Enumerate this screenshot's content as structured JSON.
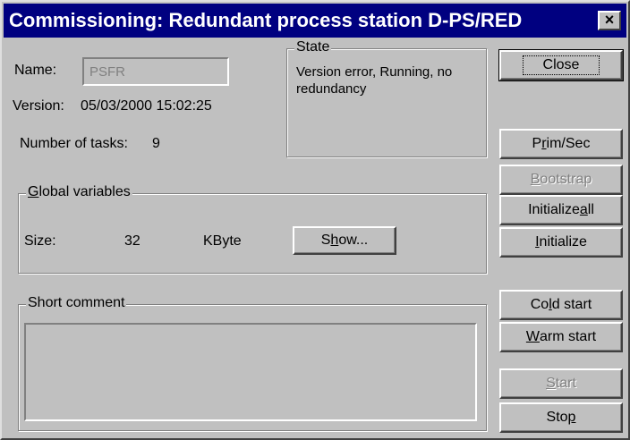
{
  "window": {
    "title": "Commissioning: Redundant process station D-PS/RED",
    "close_glyph": "×"
  },
  "name": {
    "label": "Name:",
    "value": "PSFR"
  },
  "version": {
    "label": "Version:",
    "value": "05/03/2000 15:02:25"
  },
  "tasks": {
    "label": "Number of tasks:",
    "value": "9"
  },
  "state": {
    "legend": "State",
    "text": "Version error, Running, no redundancy"
  },
  "global_vars": {
    "legend_pre": "",
    "legend_u": "G",
    "legend_post": "lobal variables",
    "size_label": "Size:",
    "size_value": "32",
    "size_unit": "KByte",
    "show_pre": "S",
    "show_u": "h",
    "show_post": "ow..."
  },
  "comment": {
    "legend": "Short comment",
    "value": ""
  },
  "buttons": {
    "close": "Close",
    "primsec_pre": "P",
    "primsec_u": "r",
    "primsec_post": "im/Sec",
    "bootstrap_pre": "",
    "bootstrap_u": "B",
    "bootstrap_post": "ootstrap",
    "initall_pre": "Initialize ",
    "initall_u": "a",
    "initall_post": "ll",
    "init_pre": "",
    "init_u": "I",
    "init_post": "nitialize",
    "cold_pre": "Co",
    "cold_u": "l",
    "cold_post": "d start",
    "warm_pre": "",
    "warm_u": "W",
    "warm_post": "arm start",
    "start_pre": "",
    "start_u": "S",
    "start_post": "tart",
    "stop_pre": "Sto",
    "stop_u": "p",
    "stop_post": ""
  }
}
